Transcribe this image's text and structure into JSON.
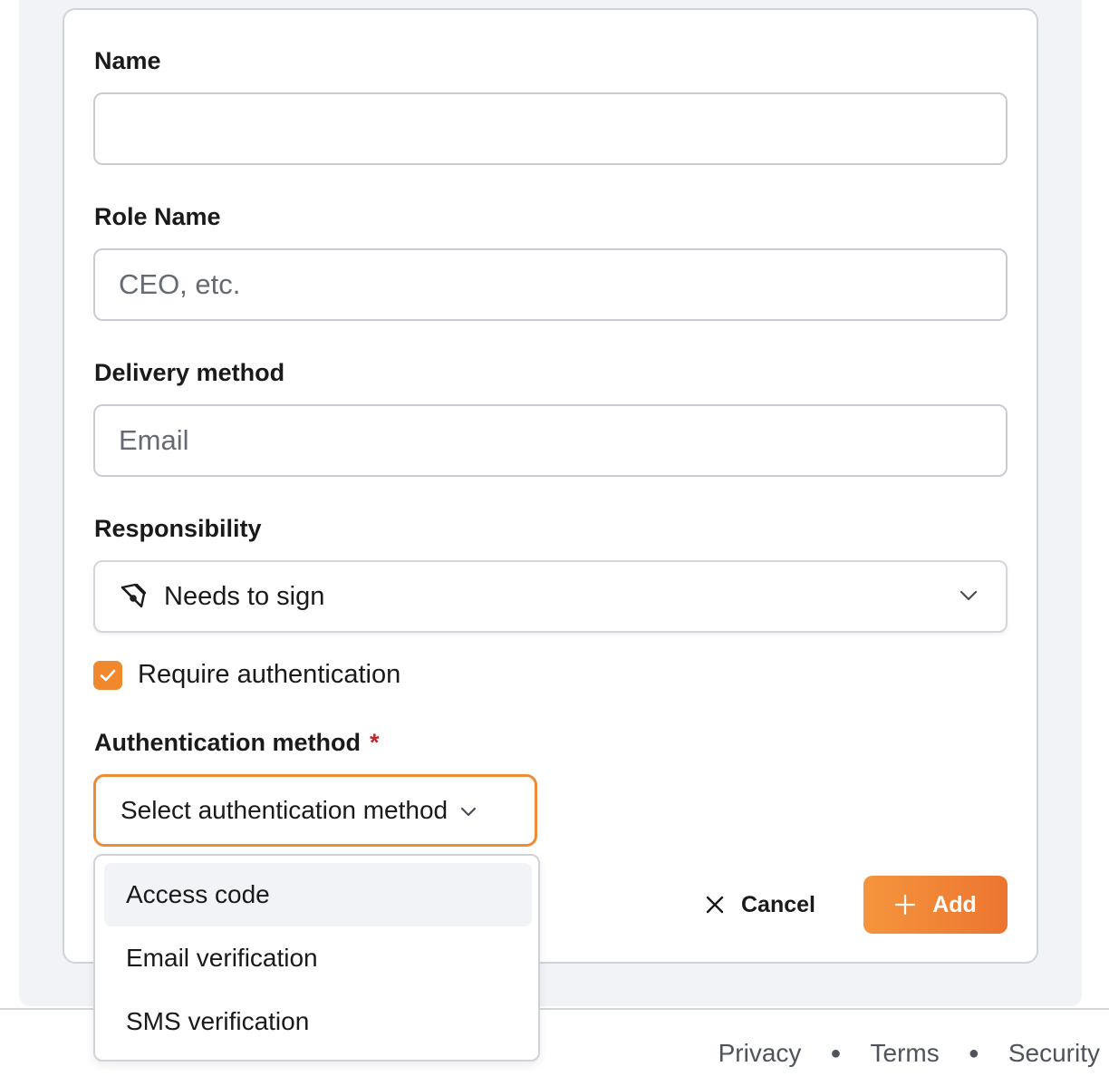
{
  "form": {
    "name_label": "Name",
    "name_value": "",
    "role_label": "Role Name",
    "role_placeholder": "CEO, etc.",
    "delivery_label": "Delivery method",
    "delivery_placeholder": "Email",
    "responsibility_label": "Responsibility",
    "responsibility_value": "Needs to sign",
    "require_auth_label": "Require authentication",
    "require_auth_checked": true,
    "auth_method_label": "Authentication method",
    "auth_method_required_mark": "*",
    "auth_method_placeholder": "Select authentication method"
  },
  "dropdown": {
    "options": [
      "Access code",
      "Email verification",
      "SMS verification"
    ],
    "highlighted": "Access code"
  },
  "actions": {
    "cancel_label": "Cancel",
    "add_label": "Add"
  },
  "footer": {
    "links": [
      "Privacy",
      "Terms",
      "Security"
    ]
  },
  "colors": {
    "accent": "#f0892e",
    "required": "#c0262d"
  },
  "icons": {
    "responsibility": "pen-tool-icon",
    "checkbox": "check-icon",
    "dropdown": "chevron-down-icon",
    "cancel": "close-icon",
    "add": "plus-icon"
  }
}
